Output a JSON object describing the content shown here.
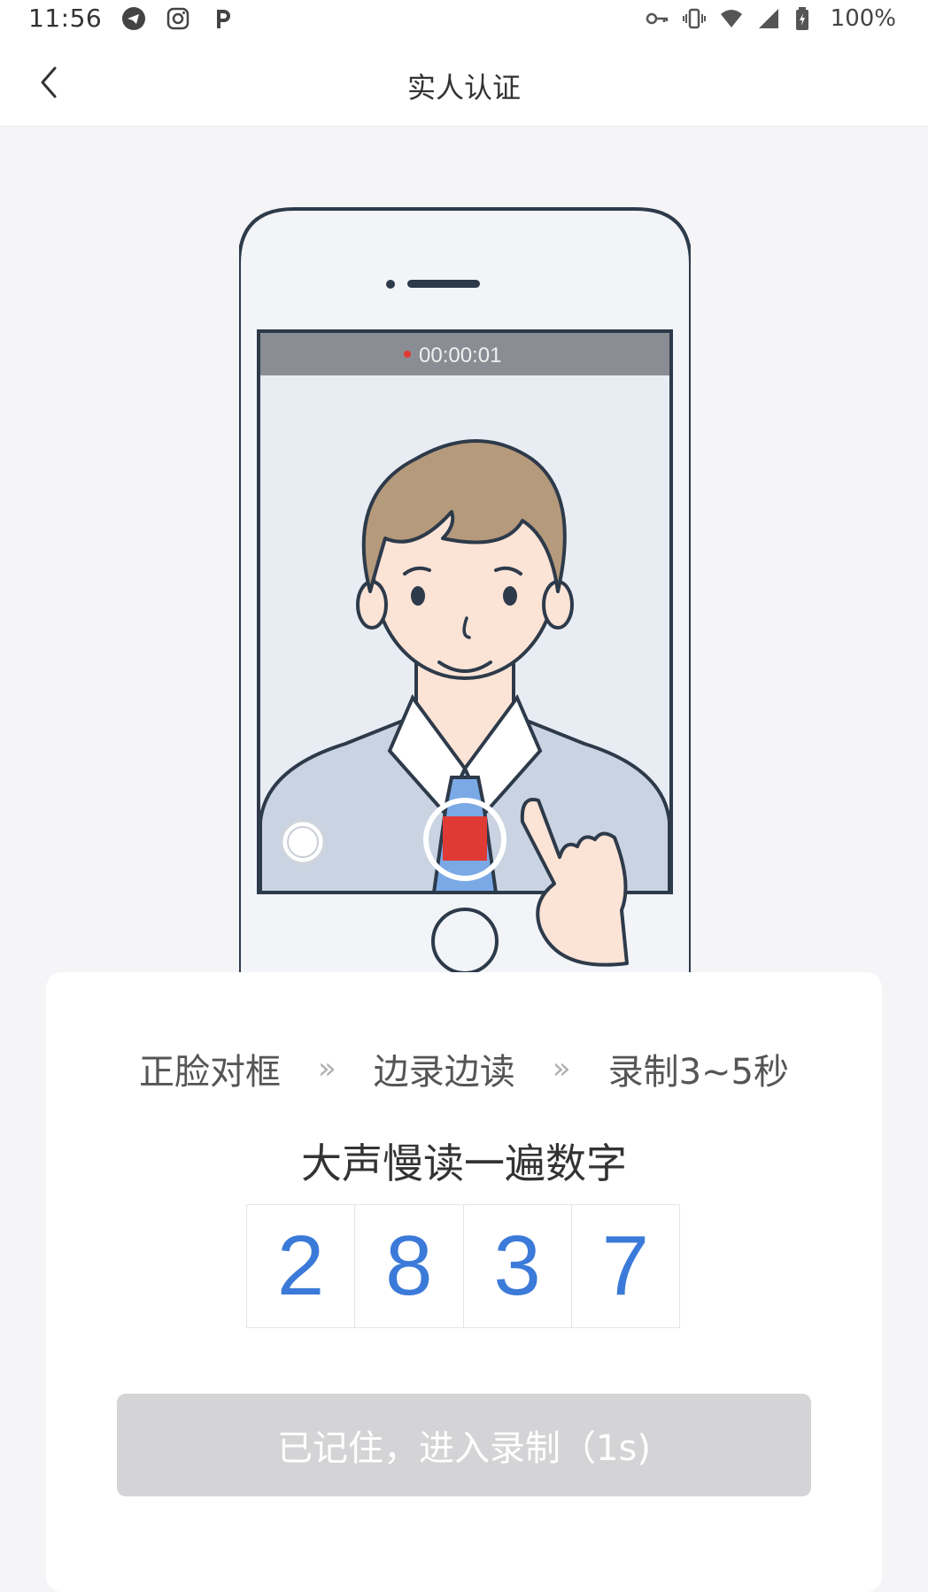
{
  "status_bar": {
    "time": "11:56",
    "battery_text": "100%",
    "icons_left": [
      "telegram-icon",
      "instagram-icon",
      "p-icon"
    ],
    "icons_right": [
      "key-icon",
      "vibrate-icon",
      "wifi-icon",
      "signal-icon",
      "battery-icon"
    ]
  },
  "navbar": {
    "title": "实人认证",
    "back_icon": "chevron-left-icon"
  },
  "illustration": {
    "recording_time": "00:00:01",
    "accent_red": "#e03a35",
    "tie_blue": "#7aa9e6"
  },
  "card": {
    "steps": [
      {
        "label": "正脸对框"
      },
      {
        "label": "边录边读"
      },
      {
        "label": "录制3~5秒"
      }
    ],
    "step_separator": "»",
    "instruction": "大声慢读一遍数字",
    "digits": [
      "2",
      "8",
      "3",
      "7"
    ],
    "button_label": "已记住，进入录制（1s)"
  },
  "colors": {
    "digit_blue": "#3b7ad9",
    "button_disabled": "#d4d4d6",
    "background": "#f5f5f7"
  }
}
